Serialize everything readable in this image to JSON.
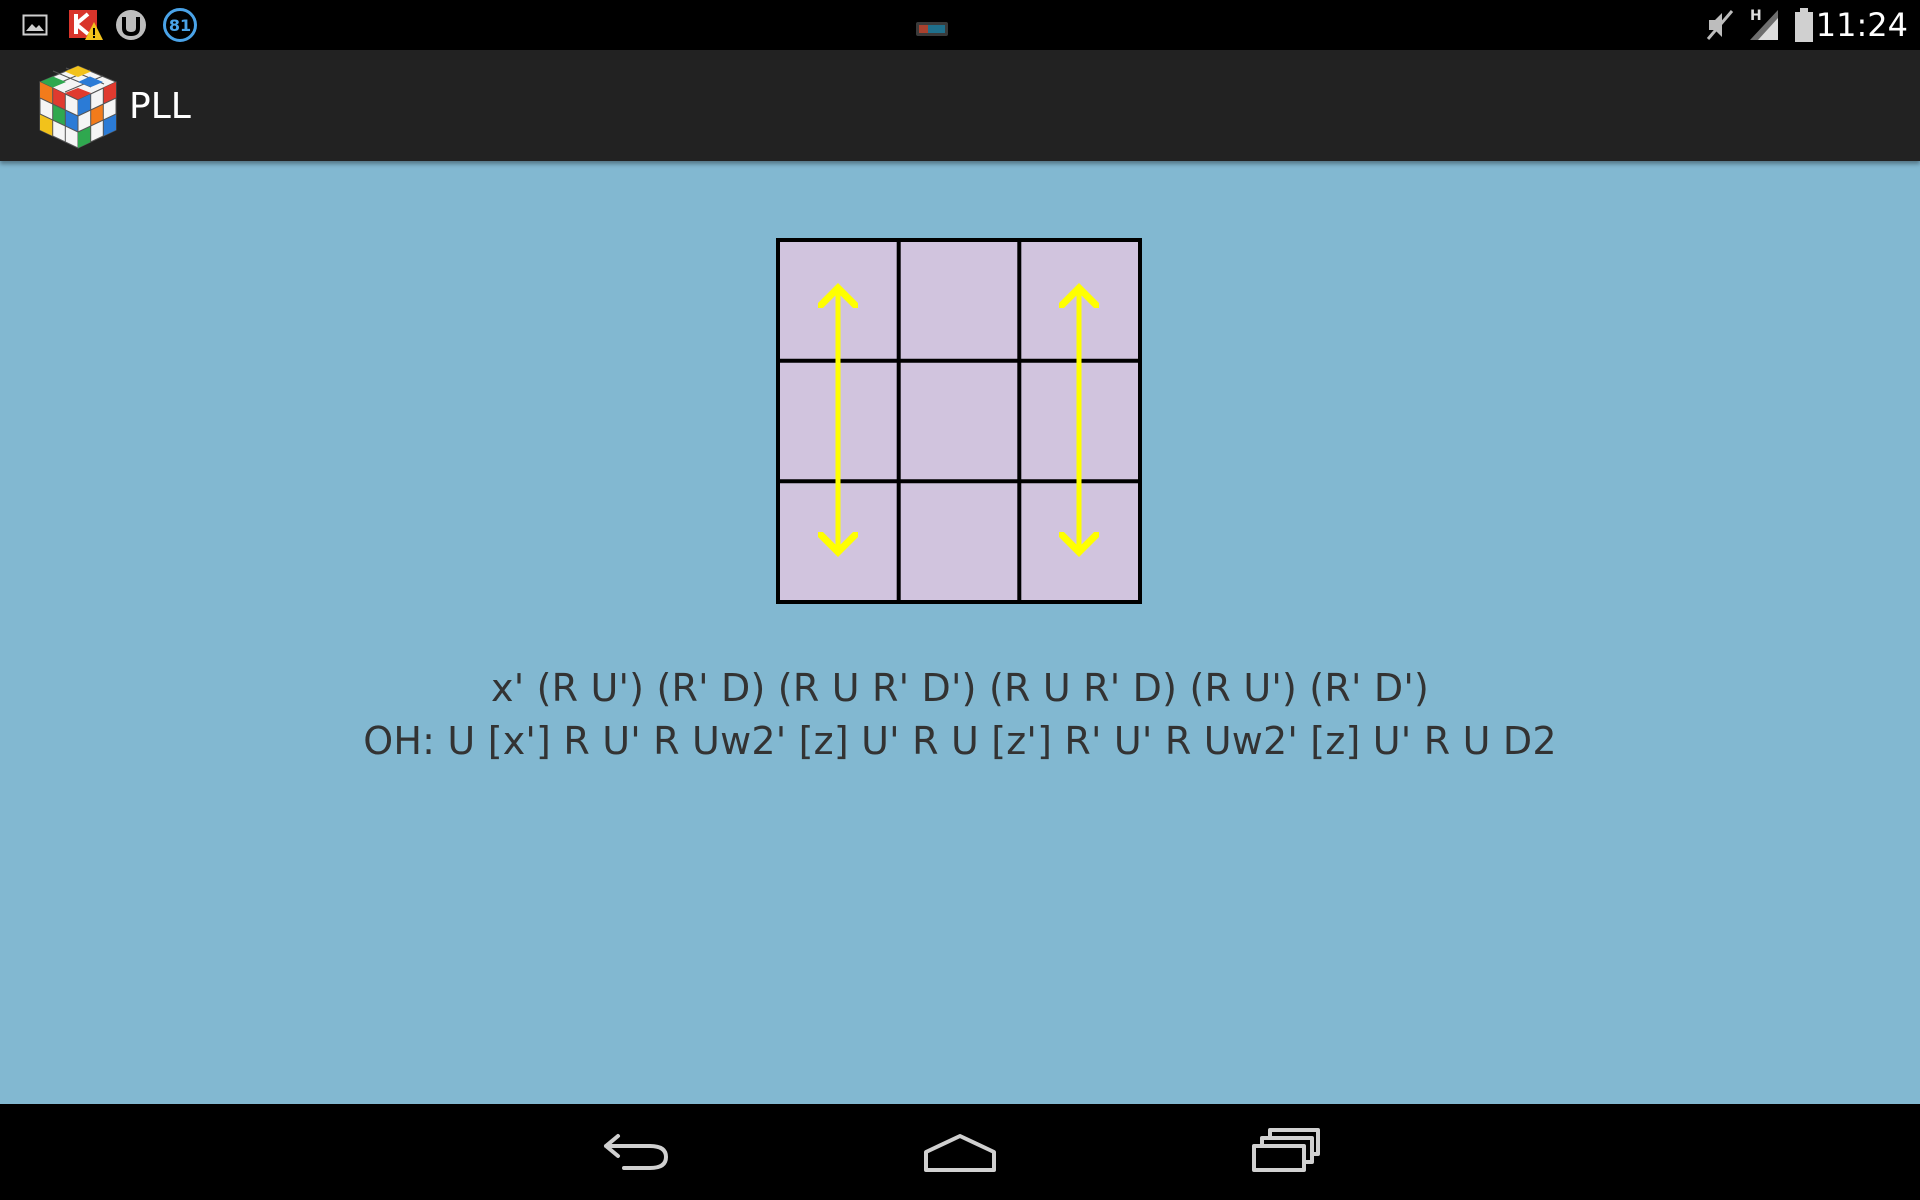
{
  "status_bar": {
    "time": "11:24",
    "notification_badge": "81",
    "network_type": "H",
    "icons": [
      "gallery-icon",
      "kaspersky-warning-icon",
      "utorrent-icon",
      "circle-81-icon",
      "cast-icon",
      "mute-icon",
      "signal-icon",
      "battery-icon"
    ]
  },
  "action_bar": {
    "title": "PLL",
    "app_icon": "rubiks-cube-icon"
  },
  "content": {
    "background": "#82b8d1",
    "diagram": {
      "rows": 3,
      "cols": 3,
      "cell_color": "#d1c4de",
      "arrow_color": "#ffff00",
      "arrows": [
        "left-column-swap-arrow",
        "right-column-swap-arrow"
      ]
    },
    "algorithm_main": "x' (R U') (R' D) (R U R' D') (R U R' D) (R U') (R' D')",
    "algorithm_oh": "OH: U [x'] R U' R Uw2' [z] U' R U [z'] R' U' R Uw2' [z] U' R U D2"
  },
  "nav_bar": {
    "buttons": [
      "back-button",
      "home-button",
      "recent-apps-button"
    ]
  }
}
